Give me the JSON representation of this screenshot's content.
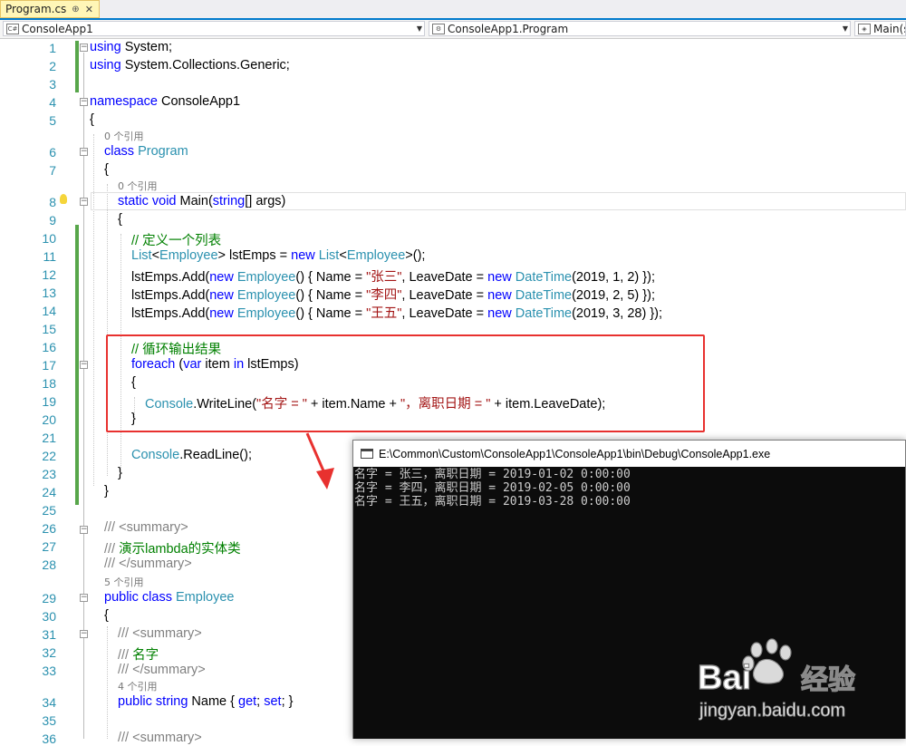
{
  "tab": {
    "title": "Program.cs",
    "pin": "⊕",
    "close": "✕"
  },
  "nav": {
    "project": "ConsoleApp1",
    "type": "ConsoleApp1.Program",
    "member": "Main(s"
  },
  "code_lens": {
    "line5": "0 个引用",
    "line7": "0 个引用",
    "line28": "5 个引用",
    "line33": "4 个引用"
  },
  "lines": {
    "l1": [
      "using",
      " System;"
    ],
    "l2": [
      "using",
      " System.Collections.Generic;"
    ],
    "l4": [
      "namespace",
      " ConsoleApp1"
    ],
    "l5": "{",
    "l6": [
      "class",
      " ",
      "Program"
    ],
    "l7": "{",
    "l8": [
      "static",
      " ",
      "void",
      " Main(",
      "string",
      "[] args)"
    ],
    "l9": "{",
    "l10": "// 定义一个列表",
    "l11": [
      "List",
      "<",
      "Employee",
      "> lstEmps = ",
      "new",
      " ",
      "List",
      "<",
      "Employee",
      ">();"
    ],
    "l12": [
      "lstEmps.Add(",
      "new",
      " ",
      "Employee",
      "() { Name = ",
      "\"张三\"",
      ", LeaveDate = ",
      "new",
      " ",
      "DateTime",
      "(2019, 1, 2) });"
    ],
    "l13": [
      "lstEmps.Add(",
      "new",
      " ",
      "Employee",
      "() { Name = ",
      "\"李四\"",
      ", LeaveDate = ",
      "new",
      " ",
      "DateTime",
      "(2019, 2, 5) });"
    ],
    "l14": [
      "lstEmps.Add(",
      "new",
      " ",
      "Employee",
      "() { Name = ",
      "\"王五\"",
      ", LeaveDate = ",
      "new",
      " ",
      "DateTime",
      "(2019, 3, 28) });"
    ],
    "l16": "// 循环输出结果",
    "l17": [
      "foreach",
      " (",
      "var",
      " item ",
      "in",
      " lstEmps)"
    ],
    "l18": "{",
    "l19": [
      "Console",
      ".WriteLine(",
      "\"名字 = \"",
      " + item.Name + ",
      "\"，离职日期 = \"",
      " + item.LeaveDate);"
    ],
    "l20": "}",
    "l22": [
      "Console",
      ".ReadLine();"
    ],
    "l23": "}",
    "l24": "}",
    "l26": [
      "/// ",
      "<summary>"
    ],
    "l27": [
      "/// ",
      "演示lambda的实体类"
    ],
    "l28": [
      "/// ",
      "</summary>"
    ],
    "l29": [
      "public",
      " ",
      "class",
      " ",
      "Employee"
    ],
    "l30": "{",
    "l31": [
      "/// ",
      "<summary>"
    ],
    "l32": [
      "/// ",
      "名字"
    ],
    "l33": [
      "/// ",
      "</summary>"
    ],
    "l34": [
      "public",
      " ",
      "string",
      " Name { ",
      "get",
      "; ",
      "set",
      "; }"
    ],
    "l36": [
      "/// ",
      "<summary>"
    ]
  },
  "console": {
    "title": "E:\\Common\\Custom\\ConsoleApp1\\ConsoleApp1\\bin\\Debug\\ConsoleApp1.exe",
    "output": [
      "名字 = 张三，离职日期 = 2019-01-02 0:00:00",
      "名字 = 李四，离职日期 = 2019-02-05 0:00:00",
      "名字 = 王五，离职日期 = 2019-03-28 0:00:00"
    ]
  },
  "watermark": {
    "brand": "Bai",
    "brand2": "经验",
    "url": "jingyan.baidu.com"
  },
  "colors": {
    "keyword": "#0000ff",
    "type": "#2b91af",
    "string": "#a31515",
    "comment": "#008000",
    "linenumber": "#2b91af",
    "highlight": "#e8312f"
  }
}
